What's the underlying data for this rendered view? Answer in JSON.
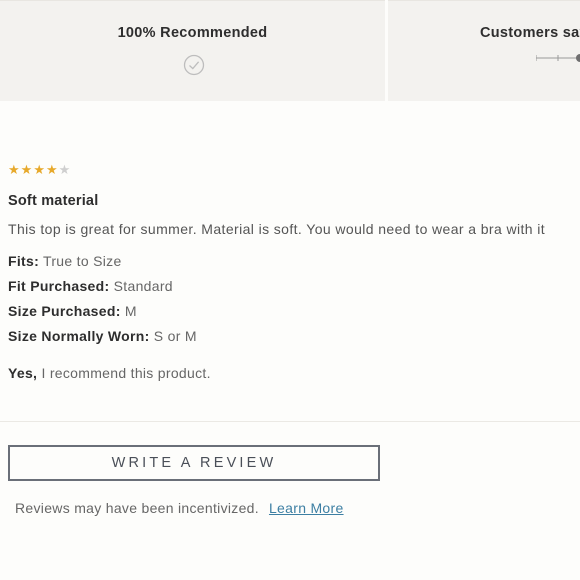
{
  "summary": {
    "recommended_label": "100% Recommended",
    "customers_say_label": "Customers say"
  },
  "review": {
    "rating": 4,
    "rating_max": 5,
    "title": "Soft material",
    "body": "This top is great for summer. Material is soft. You would need to wear a bra with it",
    "attributes": [
      {
        "key": "Fits:",
        "value": "True to Size"
      },
      {
        "key": "Fit Purchased:",
        "value": "Standard"
      },
      {
        "key": "Size Purchased:",
        "value": "M"
      },
      {
        "key": "Size Normally Worn:",
        "value": "S or M"
      }
    ],
    "recommend_yes": "Yes,",
    "recommend_text": "I recommend this product."
  },
  "actions": {
    "write_review_label": "WRITE A REVIEW",
    "incentive_text": "Reviews may have been incentivized.",
    "learn_more_label": "Learn More"
  },
  "colors": {
    "star_on": "#e7a92b",
    "star_off": "#cfcfcf",
    "link": "#3d7fa3"
  },
  "icons": {
    "recommended": "check-circle-icon",
    "fit_scale": "fit-scale-icon"
  }
}
